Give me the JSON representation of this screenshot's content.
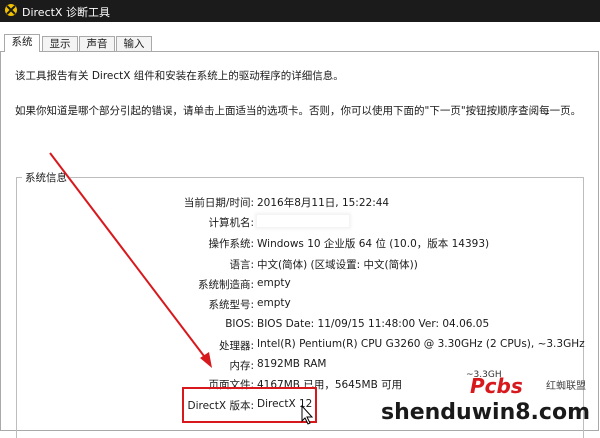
{
  "window": {
    "title": "DirectX 诊断工具"
  },
  "tabs": [
    {
      "label": "系统",
      "active": true
    },
    {
      "label": "显示",
      "active": false
    },
    {
      "label": "声音",
      "active": false
    },
    {
      "label": "输入",
      "active": false
    }
  ],
  "intro": {
    "line1": "该工具报告有关 DirectX 组件和安装在系统上的驱动程序的详细信息。",
    "line2": "如果你知道是哪个部分引起的错误，请单击上面适当的选项卡。否则，你可以使用下面的\"下一页\"按钮按顺序查阅每一页。"
  },
  "system_info": {
    "group_title": "系统信息",
    "rows": [
      {
        "label": "当前日期/时间:",
        "value": "2016年8月11日, 15:22:44"
      },
      {
        "label": "计算机名:",
        "value": ""
      },
      {
        "label": "操作系统:",
        "value": "Windows 10 企业版 64 位 (10.0，版本 14393)"
      },
      {
        "label": "语言:",
        "value": "中文(简体) (区域设置: 中文(简体))"
      },
      {
        "label": "系统制造商:",
        "value": "empty"
      },
      {
        "label": "系统型号:",
        "value": "empty"
      },
      {
        "label": "BIOS:",
        "value": "BIOS Date: 11/09/15 11:48:00 Ver: 04.06.05"
      },
      {
        "label": "处理器:",
        "value": "Intel(R) Pentium(R) CPU G3260 @ 3.30GHz (2 CPUs), ~3.3GHz"
      },
      {
        "label": "内存:",
        "value": "8192MB RAM"
      },
      {
        "label": "页面文件:",
        "value": "4167MB 已用，5645MB 可用"
      },
      {
        "label": "DirectX 版本:",
        "value": "DirectX 12"
      }
    ]
  },
  "overlay": {
    "freq_text": "~3.3GH",
    "logo_text": "Pcbs",
    "small_text": "红蜘联盟",
    "watermark": "shenduwin8.com"
  },
  "colors": {
    "annotation_red": "#d7191d",
    "titlebar": "#1b1b1b"
  }
}
